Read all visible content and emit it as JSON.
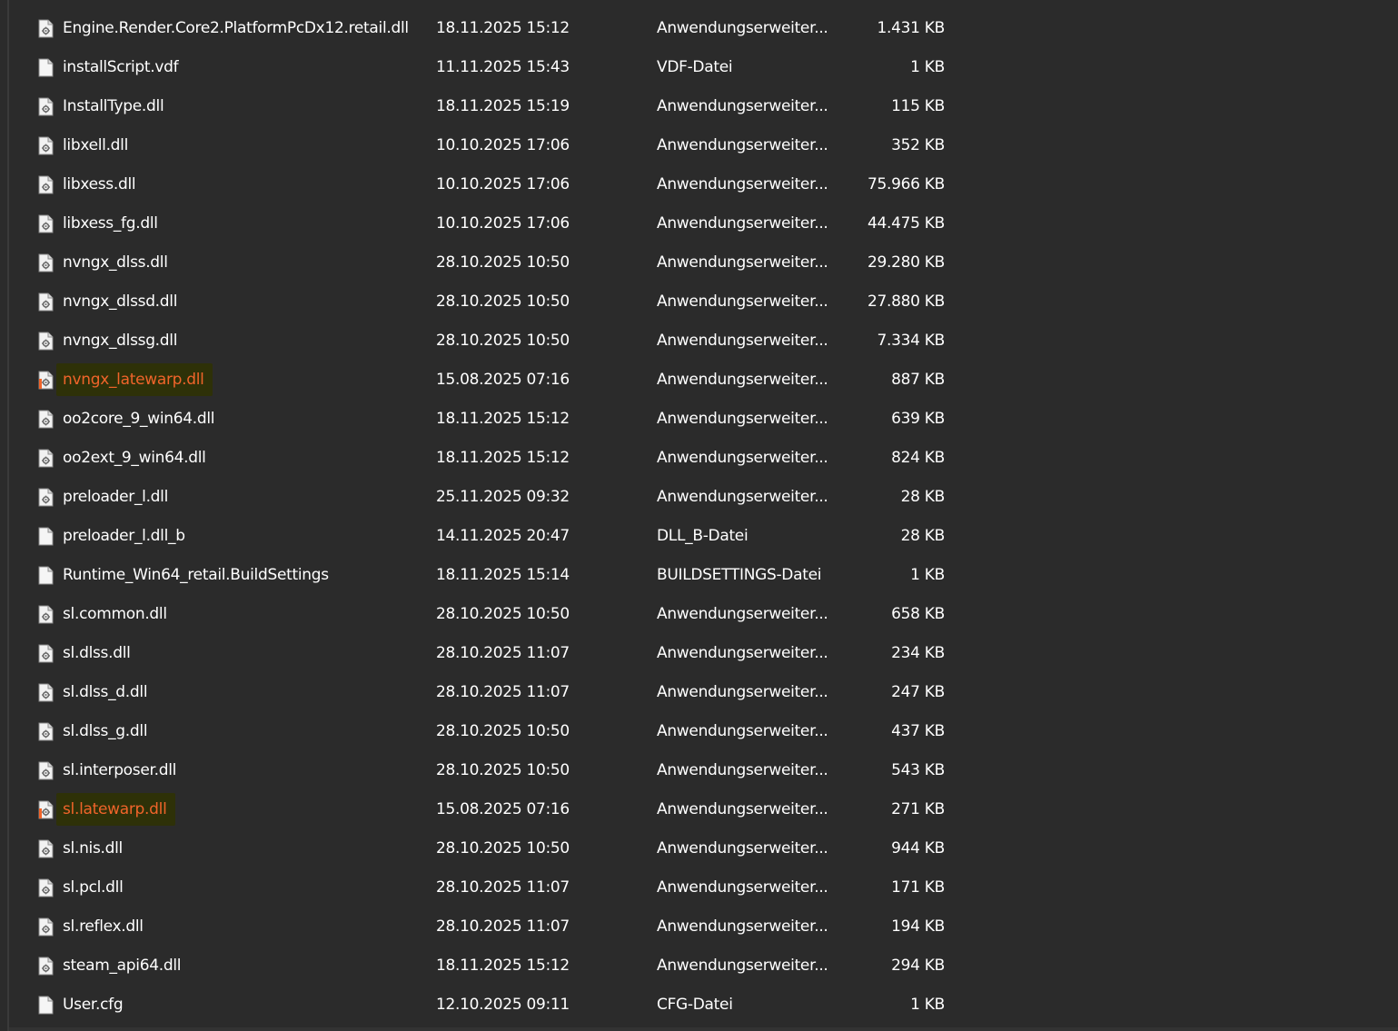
{
  "file_list": {
    "rows": [
      {
        "name": "Engine.Render.Core2.PlatformPcDx12.retail.dll",
        "date": "18.11.2025 15:12",
        "type": "Anwendungserweiter...",
        "size": "1.431 KB",
        "icon": "dll-file-icon",
        "highlighted": false
      },
      {
        "name": "installScript.vdf",
        "date": "11.11.2025 15:43",
        "type": "VDF-Datei",
        "size": "1 KB",
        "icon": "blank-file-icon",
        "highlighted": false
      },
      {
        "name": "InstallType.dll",
        "date": "18.11.2025 15:19",
        "type": "Anwendungserweiter...",
        "size": "115 KB",
        "icon": "dll-file-icon",
        "highlighted": false
      },
      {
        "name": "libxell.dll",
        "date": "10.10.2025 17:06",
        "type": "Anwendungserweiter...",
        "size": "352 KB",
        "icon": "dll-file-icon",
        "highlighted": false
      },
      {
        "name": "libxess.dll",
        "date": "10.10.2025 17:06",
        "type": "Anwendungserweiter...",
        "size": "75.966 KB",
        "icon": "dll-file-icon",
        "highlighted": false
      },
      {
        "name": "libxess_fg.dll",
        "date": "10.10.2025 17:06",
        "type": "Anwendungserweiter...",
        "size": "44.475 KB",
        "icon": "dll-file-icon",
        "highlighted": false
      },
      {
        "name": "nvngx_dlss.dll",
        "date": "28.10.2025 10:50",
        "type": "Anwendungserweiter...",
        "size": "29.280 KB",
        "icon": "dll-file-icon",
        "highlighted": false
      },
      {
        "name": "nvngx_dlssd.dll",
        "date": "28.10.2025 10:50",
        "type": "Anwendungserweiter...",
        "size": "27.880 KB",
        "icon": "dll-file-icon",
        "highlighted": false
      },
      {
        "name": "nvngx_dlssg.dll",
        "date": "28.10.2025 10:50",
        "type": "Anwendungserweiter...",
        "size": "7.334 KB",
        "icon": "dll-file-icon",
        "highlighted": false
      },
      {
        "name": "nvngx_latewarp.dll",
        "date": "15.08.2025 07:16",
        "type": "Anwendungserweiter...",
        "size": "887 KB",
        "icon": "dll-file-icon",
        "highlighted": true
      },
      {
        "name": "oo2core_9_win64.dll",
        "date": "18.11.2025 15:12",
        "type": "Anwendungserweiter...",
        "size": "639 KB",
        "icon": "dll-file-icon",
        "highlighted": false
      },
      {
        "name": "oo2ext_9_win64.dll",
        "date": "18.11.2025 15:12",
        "type": "Anwendungserweiter...",
        "size": "824 KB",
        "icon": "dll-file-icon",
        "highlighted": false
      },
      {
        "name": "preloader_l.dll",
        "date": "25.11.2025 09:32",
        "type": "Anwendungserweiter...",
        "size": "28 KB",
        "icon": "dll-file-icon",
        "highlighted": false
      },
      {
        "name": "preloader_l.dll_b",
        "date": "14.11.2025 20:47",
        "type": "DLL_B-Datei",
        "size": "28 KB",
        "icon": "blank-file-icon",
        "highlighted": false
      },
      {
        "name": "Runtime_Win64_retail.BuildSettings",
        "date": "18.11.2025 15:14",
        "type": "BUILDSETTINGS-Datei",
        "size": "1 KB",
        "icon": "blank-file-icon",
        "highlighted": false
      },
      {
        "name": "sl.common.dll",
        "date": "28.10.2025 10:50",
        "type": "Anwendungserweiter...",
        "size": "658 KB",
        "icon": "dll-file-icon",
        "highlighted": false
      },
      {
        "name": "sl.dlss.dll",
        "date": "28.10.2025 11:07",
        "type": "Anwendungserweiter...",
        "size": "234 KB",
        "icon": "dll-file-icon",
        "highlighted": false
      },
      {
        "name": "sl.dlss_d.dll",
        "date": "28.10.2025 11:07",
        "type": "Anwendungserweiter...",
        "size": "247 KB",
        "icon": "dll-file-icon",
        "highlighted": false
      },
      {
        "name": "sl.dlss_g.dll",
        "date": "28.10.2025 10:50",
        "type": "Anwendungserweiter...",
        "size": "437 KB",
        "icon": "dll-file-icon",
        "highlighted": false
      },
      {
        "name": "sl.interposer.dll",
        "date": "28.10.2025 10:50",
        "type": "Anwendungserweiter...",
        "size": "543 KB",
        "icon": "dll-file-icon",
        "highlighted": false
      },
      {
        "name": "sl.latewarp.dll",
        "date": "15.08.2025 07:16",
        "type": "Anwendungserweiter...",
        "size": "271 KB",
        "icon": "dll-file-icon",
        "highlighted": true
      },
      {
        "name": "sl.nis.dll",
        "date": "28.10.2025 10:50",
        "type": "Anwendungserweiter...",
        "size": "944 KB",
        "icon": "dll-file-icon",
        "highlighted": false
      },
      {
        "name": "sl.pcl.dll",
        "date": "28.10.2025 11:07",
        "type": "Anwendungserweiter...",
        "size": "171 KB",
        "icon": "dll-file-icon",
        "highlighted": false
      },
      {
        "name": "sl.reflex.dll",
        "date": "28.10.2025 11:07",
        "type": "Anwendungserweiter...",
        "size": "194 KB",
        "icon": "dll-file-icon",
        "highlighted": false
      },
      {
        "name": "steam_api64.dll",
        "date": "18.11.2025 15:12",
        "type": "Anwendungserweiter...",
        "size": "294 KB",
        "icon": "dll-file-icon",
        "highlighted": false
      },
      {
        "name": "User.cfg",
        "date": "12.10.2025 09:11",
        "type": "CFG-Datei",
        "size": "1 KB",
        "icon": "blank-file-icon",
        "highlighted": false
      }
    ]
  },
  "colors": {
    "background": "#2b2b2b",
    "text": "#ffffff",
    "highlight_text": "#f0642a",
    "highlight_marker": "#2e3108"
  }
}
